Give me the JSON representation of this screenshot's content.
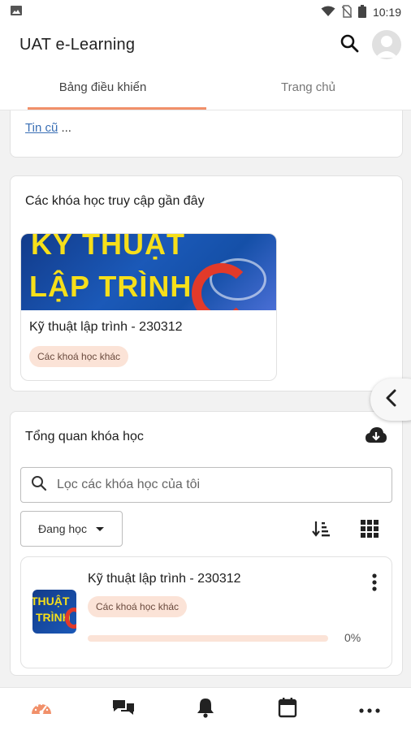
{
  "status_bar": {
    "time": "10:19"
  },
  "app": {
    "title": "UAT e-Learning"
  },
  "tabs": [
    {
      "label": "Bảng điều khiển",
      "active": true
    },
    {
      "label": "Trang chủ",
      "active": false
    }
  ],
  "news": {
    "older_link": "Tin cũ",
    "ellipsis": "..."
  },
  "recent_courses": {
    "title": "Các khóa học truy cập gần đây",
    "items": [
      {
        "image_text_line1": "KỸ THUẬT",
        "image_text_line2": "LẬP TRÌNH",
        "name": "Kỹ thuật lập trình - 230312",
        "category": "Các khoá học khác"
      }
    ]
  },
  "overview": {
    "title": "Tổng quan khóa học",
    "search_placeholder": "Lọc các khóa học của tôi",
    "filter_label": "Đang học",
    "courses": [
      {
        "thumb_line1": "THUẬT",
        "thumb_line2": "TRÌNH",
        "name": "Kỹ thuật lập trình - 230312",
        "category": "Các khoá học khác",
        "progress": 0,
        "progress_label": "0%"
      }
    ]
  },
  "colors": {
    "accent": "#f1906a",
    "pill_bg": "#fbe3d7",
    "link": "#3a6fb5"
  },
  "icons": {
    "status": [
      "image-icon",
      "wifi-icon",
      "no-sim-icon",
      "battery-icon"
    ],
    "appbar": [
      "search-icon",
      "avatar-icon"
    ],
    "bottom_nav": [
      "dashboard-icon",
      "messages-icon",
      "notifications-icon",
      "calendar-icon",
      "more-icon"
    ]
  }
}
